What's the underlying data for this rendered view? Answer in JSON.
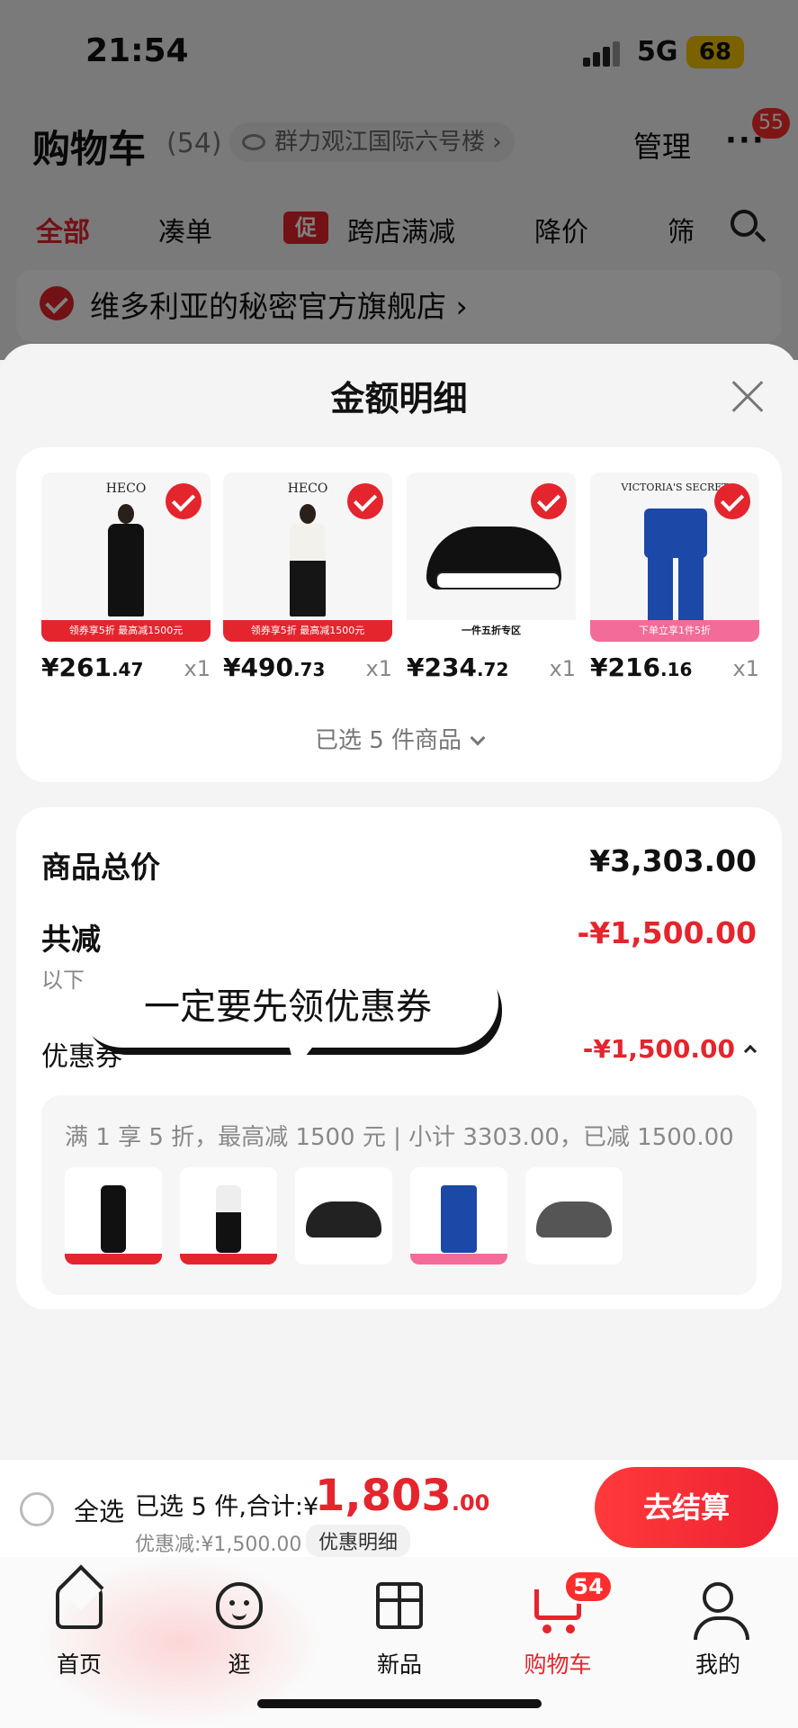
{
  "status_bar": {
    "time": "21:54",
    "network": "5G",
    "battery": "68"
  },
  "cart_header": {
    "title": "购物车",
    "count": "(54)",
    "address": "群力观江国际六号楼 ›",
    "manage": "管理",
    "more": "···",
    "more_badge": "55"
  },
  "filter_tabs": {
    "all": "全部",
    "bundle": "凑单",
    "promo_tag": "促",
    "cross_store": "跨店满减",
    "price_drop": "降价",
    "filter": "筛"
  },
  "store": {
    "name": "维多利亚的秘密官方旗舰店 ›"
  },
  "sheet": {
    "title": "金额明细",
    "products": [
      {
        "brand": "HECO",
        "banner": "领券享5折 最高减1500元",
        "price_int": "¥261",
        "price_dec": ".47",
        "qty": "x1"
      },
      {
        "brand": "HECO",
        "banner": "领券享5折 最高减1500元",
        "price_int": "¥490",
        "price_dec": ".73",
        "qty": "x1"
      },
      {
        "brand": "",
        "banner": "一件五折专区",
        "price_int": "¥234",
        "price_dec": ".72",
        "qty": "x1"
      },
      {
        "brand": "VICTORIA'S SECRET",
        "banner": "下单立享1件5折",
        "price_int": "¥216",
        "price_dec": ".16",
        "qty": "x1"
      }
    ],
    "selected_text": "已选 5 件商品",
    "total_label": "商品总价",
    "total_value": "¥3,303.00",
    "reduce_label": "共减",
    "reduce_value": "-¥1,500.00",
    "reduce_sub": "以下",
    "coupon_label": "优惠券",
    "coupon_value": "-¥1,500.00",
    "coupon_desc": "满 1 享 5 折，最高减 1500 元 | 小计 3303.00，已减 1500.00",
    "caption": "一定要先领优惠券"
  },
  "checkout": {
    "select_all": "全选",
    "summary": "已选 5 件,合计:¥",
    "total_int": "1,803",
    "total_dec": ".00",
    "discount": "优惠减:¥1,500.00",
    "detail": "优惠明细",
    "pay": "去结算"
  },
  "tabbar": {
    "home": "首页",
    "browse": "逛",
    "new": "新品",
    "cart": "购物车",
    "cart_badge": "54",
    "mine": "我的"
  },
  "colors": {
    "accent": "#e4252d",
    "background": "#f4f4f4"
  }
}
